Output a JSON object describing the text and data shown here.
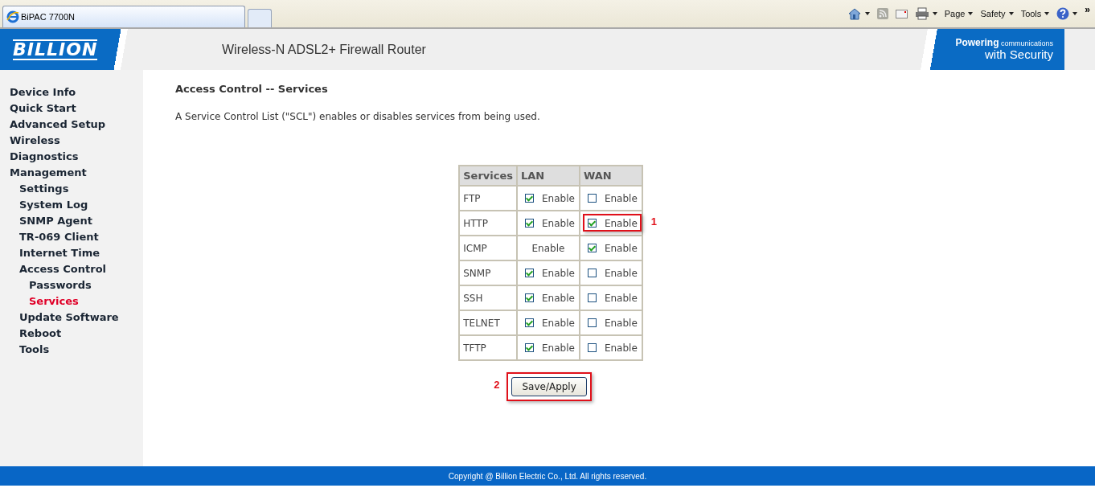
{
  "browser": {
    "tab_title": "BiPAC 7700N",
    "commands": [
      "Page",
      "Safety",
      "Tools"
    ],
    "overflow": "»"
  },
  "banner": {
    "logo": "BILLION",
    "title": "Wireless-N ADSL2+ Firewall Router",
    "tagline": [
      "**Powering** communications",
      "with Security"
    ]
  },
  "sidebar": {
    "items": [
      {
        "label": "Device Info",
        "selected": false
      },
      {
        "label": "Quick Start",
        "selected": false
      },
      {
        "label": "Advanced Setup",
        "selected": false
      },
      {
        "label": "Wireless",
        "selected": false
      },
      {
        "label": "Diagnostics",
        "selected": false
      },
      {
        "label": "Management",
        "selected": false,
        "children": [
          {
            "label": "Settings",
            "selected": false
          },
          {
            "label": "System Log",
            "selected": false
          },
          {
            "label": "SNMP Agent",
            "selected": false
          },
          {
            "label": "TR-069 Client",
            "selected": false
          },
          {
            "label": "Internet Time",
            "selected": false
          },
          {
            "label": "Access Control",
            "selected": false,
            "children": [
              {
                "label": "Passwords",
                "selected": false
              },
              {
                "label": "Services",
                "selected": true
              }
            ]
          },
          {
            "label": "Update Software",
            "selected": false
          },
          {
            "label": "Reboot",
            "selected": false
          },
          {
            "label": "Tools",
            "selected": false
          }
        ]
      }
    ]
  },
  "content": {
    "heading": "Access Control -- Services",
    "description": "A Service Control List (\"SCL\") enables or disables services from being used.",
    "table": {
      "columns": [
        "Services",
        "LAN",
        "WAN"
      ],
      "rows": [
        {
          "service": "FTP",
          "lan": {
            "kind": "checkbox",
            "checked": true,
            "label": "Enable"
          },
          "wan": {
            "kind": "checkbox",
            "checked": false,
            "label": "Enable"
          }
        },
        {
          "service": "HTTP",
          "lan": {
            "kind": "checkbox",
            "checked": true,
            "label": "Enable"
          },
          "wan": {
            "kind": "checkbox",
            "checked": true,
            "label": "Enable",
            "callout": "1"
          }
        },
        {
          "service": "ICMP",
          "lan": {
            "kind": "text",
            "label": "Enable"
          },
          "wan": {
            "kind": "checkbox",
            "checked": true,
            "label": "Enable"
          }
        },
        {
          "service": "SNMP",
          "lan": {
            "kind": "checkbox",
            "checked": true,
            "label": "Enable"
          },
          "wan": {
            "kind": "checkbox",
            "checked": false,
            "label": "Enable"
          }
        },
        {
          "service": "SSH",
          "lan": {
            "kind": "checkbox",
            "checked": true,
            "label": "Enable"
          },
          "wan": {
            "kind": "checkbox",
            "checked": false,
            "label": "Enable"
          }
        },
        {
          "service": "TELNET",
          "lan": {
            "kind": "checkbox",
            "checked": true,
            "label": "Enable"
          },
          "wan": {
            "kind": "checkbox",
            "checked": false,
            "label": "Enable"
          }
        },
        {
          "service": "TFTP",
          "lan": {
            "kind": "checkbox",
            "checked": true,
            "label": "Enable"
          },
          "wan": {
            "kind": "checkbox",
            "checked": false,
            "label": "Enable"
          }
        }
      ]
    },
    "button": {
      "label": "Save/Apply",
      "callout": "2"
    }
  },
  "footer": "Copyright @ Billion Electric Co., Ltd. All rights reserved."
}
